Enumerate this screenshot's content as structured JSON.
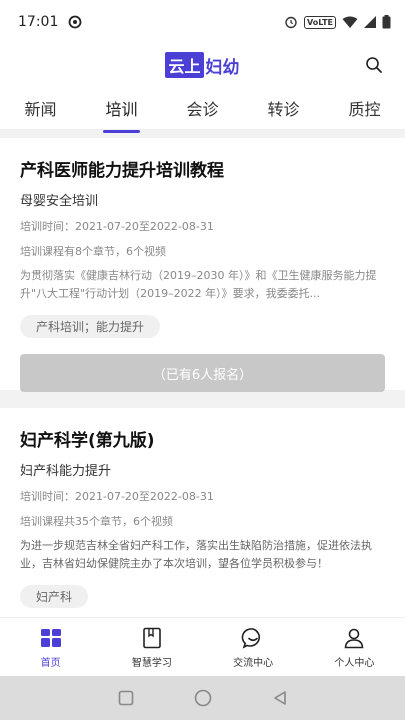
{
  "status": {
    "time": "17:01",
    "network": "VoLTE"
  },
  "header": {
    "logo_box": "云上",
    "logo_rest": "妇幼"
  },
  "tabs": [
    {
      "label": "新闻",
      "active": false
    },
    {
      "label": "培训",
      "active": true
    },
    {
      "label": "会诊",
      "active": false
    },
    {
      "label": "转诊",
      "active": false
    },
    {
      "label": "质控",
      "active": false
    }
  ],
  "cards": [
    {
      "title": "产科医师能力提升培训教程",
      "subtitle": "母婴安全培训",
      "time": "培训时间：2021-07-20至2022-08-31",
      "chapters": "培训课程有8个章节，6个视频",
      "description": "为贯彻落实《健康吉林行动（2019–2030 年）》和《卫生健康服务能力提升\"八大工程\"行动计划（2019–2022 年）》要求，我委委托...",
      "tag": "产科培训；能力提升",
      "button": "（已有6人报名）"
    },
    {
      "title": "妇产科学(第九版)",
      "subtitle": "妇产科能力提升",
      "time": "培训时间：2021-07-20至2022-08-31",
      "chapters": "培训课程共35个章节，6个视频",
      "description": "为进一步规范吉林全省妇产科工作，落实出生缺陷防治措施，促进依法执业，吉林省妇幼保健院主办了本次培训，望各位学员积极参与！",
      "tag": "妇产科"
    }
  ],
  "bottom_nav": [
    {
      "label": "首页",
      "icon": "home-grid-icon",
      "active": true
    },
    {
      "label": "智慧学习",
      "icon": "book-icon",
      "active": false
    },
    {
      "label": "交流中心",
      "icon": "chat-bubble-icon",
      "active": false
    },
    {
      "label": "个人中心",
      "icon": "person-icon",
      "active": false
    }
  ],
  "colors": {
    "accent": "#4b3fd6",
    "disabled_button": "#c8c8c8"
  }
}
